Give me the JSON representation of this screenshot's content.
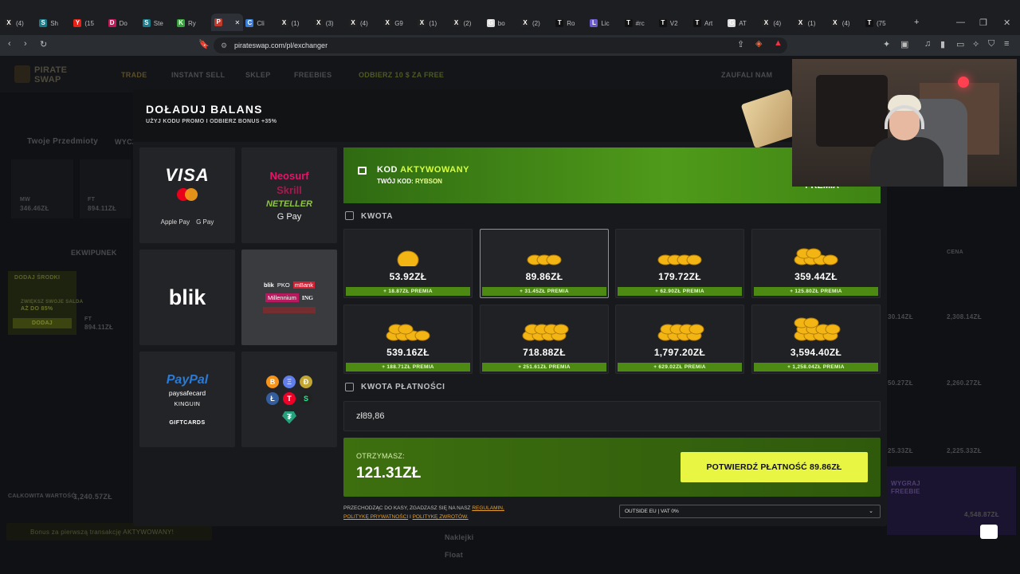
{
  "browser": {
    "tabs": [
      {
        "label": "(4)",
        "icon": "X"
      },
      {
        "label": "Sh",
        "icon": "S"
      },
      {
        "label": "(15",
        "icon": "Y"
      },
      {
        "label": "Do",
        "icon": "D"
      },
      {
        "label": "Ste",
        "icon": "S"
      },
      {
        "label": "Ry",
        "icon": "K"
      },
      {
        "label": "",
        "icon": "P"
      },
      {
        "label": "Cli",
        "icon": "C"
      },
      {
        "label": "(1)",
        "icon": "X"
      },
      {
        "label": "(3)",
        "icon": "X"
      },
      {
        "label": "(4)",
        "icon": "X"
      },
      {
        "label": "G9",
        "icon": "X"
      },
      {
        "label": "(1)",
        "icon": "X"
      },
      {
        "label": "(2)",
        "icon": "X"
      },
      {
        "label": "bo",
        "icon": "G"
      },
      {
        "label": "(2)",
        "icon": "X"
      },
      {
        "label": "Ro",
        "icon": "T"
      },
      {
        "label": "Lic",
        "icon": "L"
      },
      {
        "label": "#rc",
        "icon": "T"
      },
      {
        "label": "V2",
        "icon": "T"
      },
      {
        "label": "Art",
        "icon": "T"
      },
      {
        "label": "AT",
        "icon": "G"
      },
      {
        "label": "(4)",
        "icon": "X"
      },
      {
        "label": "(1)",
        "icon": "X"
      },
      {
        "label": "(4)",
        "icon": "X"
      },
      {
        "label": "(75",
        "icon": "T"
      }
    ],
    "new_tab": "+",
    "url": "pirateswap.com/pl/exchanger"
  },
  "site": {
    "logo_line1": "PIRATE",
    "logo_line2": "SWAP",
    "nav": [
      "TRADE",
      "INSTANT SELL",
      "SKLEP",
      "FREEBIES",
      "ODBIERZ 10 $ ZA FREE",
      "ZAUFALI NAM"
    ],
    "left": {
      "items_title": "Twoje Przedmioty",
      "wycz": "WYCZ",
      "item1_wear": "MW",
      "item1_price": "346.46ZŁ",
      "item2_wear": "FT",
      "item2_price": "894.11ZŁ",
      "ekwipunek": "EKWIPUNEK",
      "dodaj_srodki": "DODAJ ŚRODKI",
      "zwieksz": "ZWIĘKSZ SWOJE SALDA",
      "bonus": "AŻ DO 85%",
      "dodaj_btn": "DODAJ",
      "item3_wear": "FT",
      "item3_price": "894.11ZŁ",
      "total_label": "CAŁKOWITA WARTOŚĆ:",
      "total_value": "1,240.57ZŁ",
      "bonus_bar": "Bonus za pierwszą transakcję AKTYWOWANY!"
    },
    "right": {
      "cena": "CENA",
      "prices": [
        "30.14ZŁ",
        "2,308.14ZŁ",
        "50.27ZŁ",
        "2,260.27ZŁ",
        "25.33ZŁ",
        "2,225.33ZŁ",
        "4,548.87ZŁ"
      ],
      "wygraj": "WYGRAJ",
      "freebie": "FREEBIE"
    },
    "bottom": {
      "naklejki": "Naklejki",
      "float": "Float"
    }
  },
  "modal": {
    "title": "DOŁADUJ BALANS",
    "subtitle": "UŻYJ KODU PROMO I ODBIERZ BONUS +35%",
    "methods": [
      {
        "name": "card",
        "lines": [
          "VISA",
          "Apple Pay",
          "G Pay"
        ]
      },
      {
        "name": "neosurf",
        "lines": [
          "Neosurf",
          "Skrill",
          "NETELLER",
          "G Pay"
        ]
      },
      {
        "name": "blik",
        "lines": [
          "blik"
        ]
      },
      {
        "name": "banks",
        "lines": [
          "blik",
          "PKO",
          "mBank",
          "Millennium",
          "ING"
        ]
      },
      {
        "name": "paypal",
        "lines": [
          "PayPal",
          "paysafecard",
          "KINGUIN",
          "GIFTCARDS"
        ]
      },
      {
        "name": "crypto",
        "lines": [
          "B",
          "Ξ",
          "Ð",
          "Ł",
          "T",
          "S",
          "₮"
        ]
      }
    ],
    "promo": {
      "title_a": "KOD",
      "title_b": "AKTYWOWANY",
      "code_label": "TWÓJ KOD:",
      "code": "RYBSON",
      "bonus": "+3",
      "bonus_label": "PREMIA"
    },
    "amount_label": "KWOTA",
    "amounts": [
      {
        "value": "53.92ZŁ",
        "premium": "+ 18.87ZŁ PREMIA",
        "coins": 1
      },
      {
        "value": "89.86ZŁ",
        "premium": "+ 31.45ZŁ PREMIA",
        "coins": 3
      },
      {
        "value": "179.72ZŁ",
        "premium": "+ 62.90ZŁ PREMIA",
        "coins": 4
      },
      {
        "value": "359.44ZŁ",
        "premium": "+ 125.80ZŁ PREMIA",
        "coins": 6
      },
      {
        "value": "539.16ZŁ",
        "premium": "+ 188.71ZŁ PREMIA",
        "coins": 6
      },
      {
        "value": "718.88ZŁ",
        "premium": "+ 251.61ZŁ PREMIA",
        "coins": 8
      },
      {
        "value": "1,797.20ZŁ",
        "premium": "+ 629.02ZŁ PREMIA",
        "coins": 8
      },
      {
        "value": "3,594.40ZŁ",
        "premium": "+ 1,258.04ZŁ PREMIA",
        "coins": 10
      }
    ],
    "selected_amount_index": 1,
    "payment_label": "KWOTA PŁATNOŚCI",
    "payment_value": "zł89,86",
    "receive_label": "OTRZYMASZ:",
    "receive_value": "121.31ZŁ",
    "confirm_label": "POTWIERDŹ PŁATNOŚĆ 89.86ZŁ",
    "legal_text": "PRZECHODZĄC DO KASY, ZGADZASZ SIĘ NA NASZ",
    "legal_link1": "REGULAMIN,",
    "legal_link2": "POLITYKĘ PRYWATNOŚCI",
    "legal_sep": "I",
    "legal_link3": "POLITYKĘ ZWROTÓW.",
    "region": "OUTSIDE EU | VAT 0%"
  },
  "colors": {
    "accent_yellow": "#e8f542",
    "promo_green": "#4f9a1a",
    "premium_green": "#4d8a14",
    "gold": "#f3b514"
  }
}
